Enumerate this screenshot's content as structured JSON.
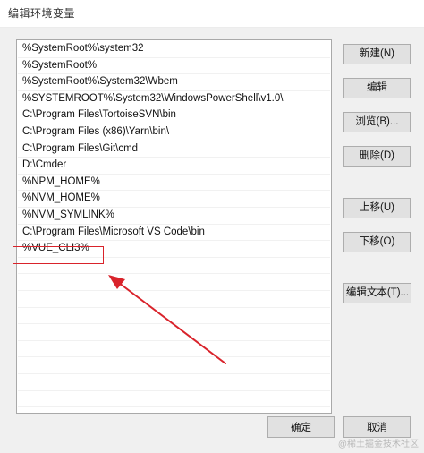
{
  "window": {
    "title": "编辑环境变量"
  },
  "env_list": {
    "items": [
      "%SystemRoot%\\system32",
      "%SystemRoot%",
      "%SystemRoot%\\System32\\Wbem",
      "%SYSTEMROOT%\\System32\\WindowsPowerShell\\v1.0\\",
      "C:\\Program Files\\TortoiseSVN\\bin",
      "C:\\Program Files (x86)\\Yarn\\bin\\",
      "C:\\Program Files\\Git\\cmd",
      "D:\\Cmder",
      "%NPM_HOME%",
      "%NVM_HOME%",
      "%NVM_SYMLINK%",
      "C:\\Program Files\\Microsoft VS Code\\bin",
      "%VUE_CLI3%"
    ]
  },
  "buttons": {
    "new": "新建(N)",
    "edit": "编辑",
    "browse": "浏览(B)...",
    "delete": "删除(D)",
    "move_up": "上移(U)",
    "move_down": "下移(O)",
    "edit_text": "编辑文本(T)...",
    "ok": "确定",
    "cancel": "取消"
  },
  "annotation": {
    "highlight_color": "#d9232b"
  },
  "watermark": {
    "text": "@稀土掘金技术社区"
  }
}
